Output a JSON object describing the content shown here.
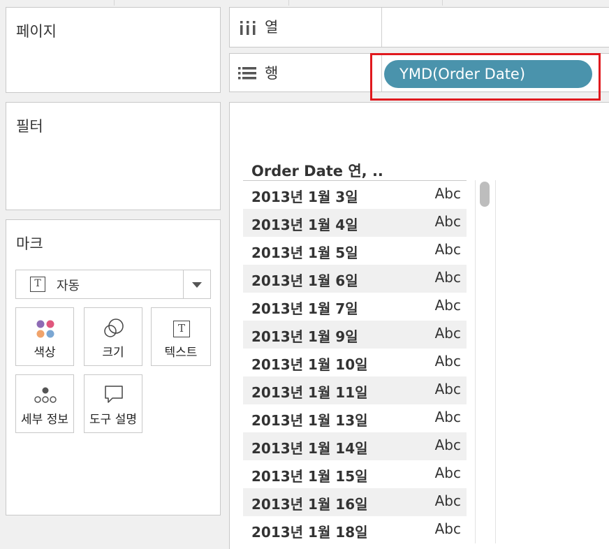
{
  "pages_panel": {
    "title": "페이지"
  },
  "filters_panel": {
    "title": "필터"
  },
  "marks_panel": {
    "title": "마크",
    "mark_type": {
      "icon": "text-mark-icon",
      "label": "자동"
    },
    "buttons": [
      {
        "label": "색상",
        "icon": "color-dots-icon"
      },
      {
        "label": "크기",
        "icon": "size-circles-icon"
      },
      {
        "label": "텍스트",
        "icon": "text-mark-icon"
      },
      {
        "label": "세부 정보",
        "icon": "detail-dots-icon"
      },
      {
        "label": "도구 설명",
        "icon": "tooltip-bubble-icon"
      }
    ]
  },
  "columns_shelf": {
    "icon": "columns-icon",
    "label": "열"
  },
  "rows_shelf": {
    "icon": "rows-icon",
    "label": "행",
    "pill": "YMD(Order Date)"
  },
  "view": {
    "header": "Order Date 연, ..",
    "rows": [
      {
        "date": "2013년 1월 3일",
        "value": "Abc"
      },
      {
        "date": "2013년 1월 4일",
        "value": "Abc"
      },
      {
        "date": "2013년 1월 5일",
        "value": "Abc"
      },
      {
        "date": "2013년 1월 6일",
        "value": "Abc"
      },
      {
        "date": "2013년 1월 7일",
        "value": "Abc"
      },
      {
        "date": "2013년 1월 9일",
        "value": "Abc"
      },
      {
        "date": "2013년 1월 10일",
        "value": "Abc"
      },
      {
        "date": "2013년 1월 11일",
        "value": "Abc"
      },
      {
        "date": "2013년 1월 13일",
        "value": "Abc"
      },
      {
        "date": "2013년 1월 14일",
        "value": "Abc"
      },
      {
        "date": "2013년 1월 15일",
        "value": "Abc"
      },
      {
        "date": "2013년 1월 16일",
        "value": "Abc"
      },
      {
        "date": "2013년 1월 18일",
        "value": "Abc"
      }
    ]
  },
  "colors": {
    "pill": "#4a93ac",
    "highlight": "#e0191e"
  }
}
